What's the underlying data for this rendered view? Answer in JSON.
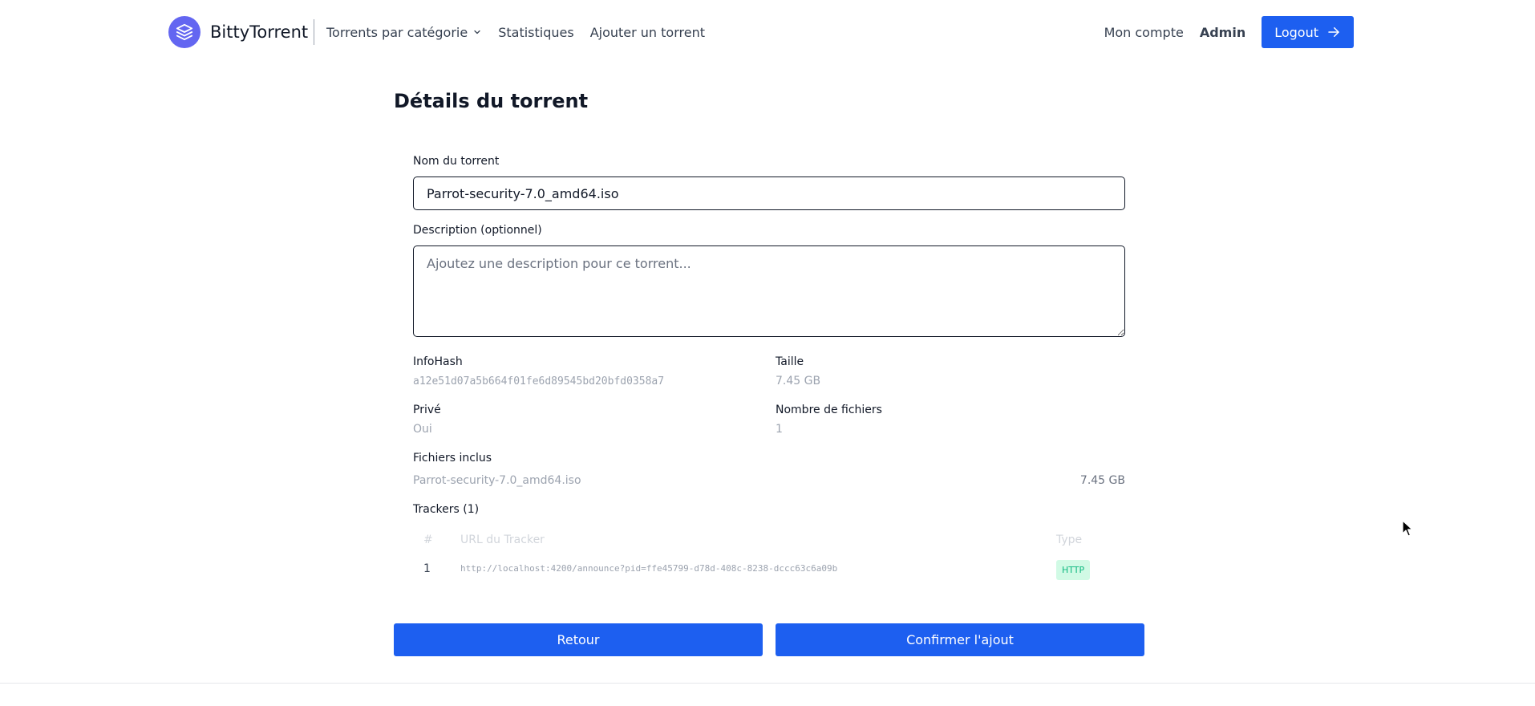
{
  "navbar": {
    "brand": "BittyTorrent",
    "links": [
      {
        "label": "Torrents par catégorie",
        "dropdown": true
      },
      {
        "label": "Statistiques"
      },
      {
        "label": "Ajouter un torrent"
      }
    ],
    "account": "Mon compte",
    "admin": "Admin",
    "logout": "Logout"
  },
  "page": {
    "title": "Détails du torrent"
  },
  "form": {
    "name_label": "Nom du torrent",
    "name_value": "Parrot-security-7.0_amd64.iso",
    "description_label": "Description (optionnel)",
    "description_placeholder": "Ajoutez une description pour ce torrent..."
  },
  "details": {
    "infohash_label": "InfoHash",
    "infohash_value": "a12e51d07a5b664f01fe6d89545bd20bfd0358a7",
    "size_label": "Taille",
    "size_value": "7.45 GB",
    "private_label": "Privé",
    "private_value": "Oui",
    "file_count_label": "Nombre de fichiers",
    "file_count_value": "1"
  },
  "files": {
    "label": "Fichiers inclus",
    "items": [
      {
        "name": "Parrot-security-7.0_amd64.iso",
        "size": "7.45 GB"
      }
    ]
  },
  "trackers": {
    "label": "Trackers (1)",
    "columns": [
      "#",
      "URL du Tracker",
      "Type"
    ],
    "rows": [
      {
        "num": "1",
        "url": "http://localhost:4200/announce?pid=ffe45799-d78d-408c-8238-dccc63c6a09b",
        "type": "HTTP"
      }
    ]
  },
  "actions": {
    "back": "Retour",
    "confirm": "Confirmer l'ajout"
  },
  "colors": {
    "primary": "#1d5ff0",
    "logo": "#6366f1",
    "badge_bg": "#d1fae5",
    "badge_text": "#10b981"
  },
  "icons": {
    "logo": "layers-icon",
    "dropdown": "chevron-down-icon",
    "logout": "arrow-right-icon",
    "cursor": "mouse-pointer-icon"
  }
}
